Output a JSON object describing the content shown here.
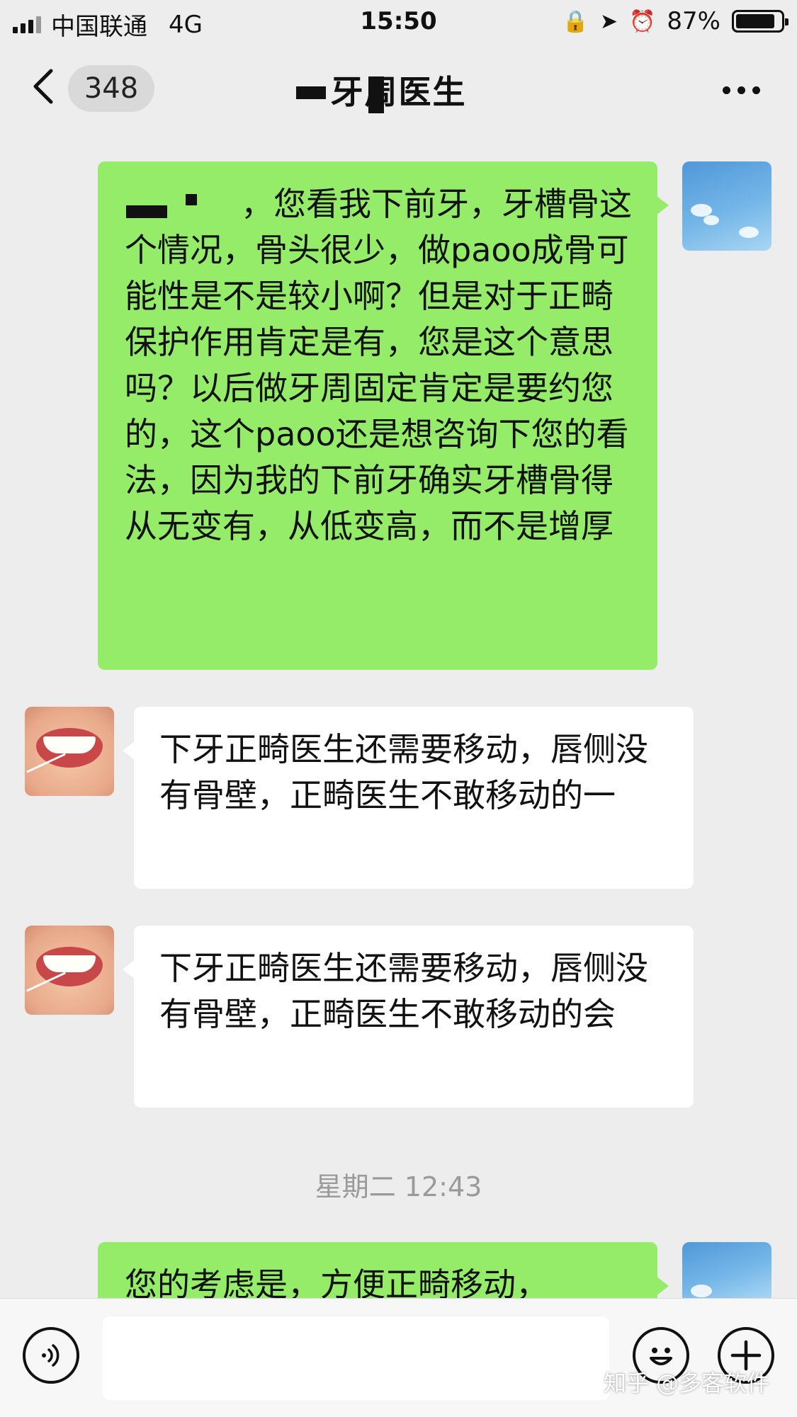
{
  "status_bar": {
    "carrier": "中国联通",
    "network": "4G",
    "time": "15:50",
    "battery": "87%"
  },
  "nav": {
    "unread_count": "348",
    "title": "牙周医生"
  },
  "messages": [
    {
      "side": "out",
      "text": "，您看我下前牙，牙槽骨这个情况，骨头很少，做paoo成骨可能性是不是较小啊？但是对于正畸保护作用肯定是有，您是这个意思吗？以后做牙周固定肯定是要约您的，这个paoo还是想咨询下您的看法，因为我的下前牙确实牙槽骨得从无变有，从低变高，而不是增厚"
    },
    {
      "side": "in",
      "text": "下牙正畸医生还需要移动，唇侧没有骨壁，正畸医生不敢移动的一"
    },
    {
      "side": "in",
      "text": "下牙正畸医生还需要移动，唇侧没有骨壁，正畸医生不敢移动的会"
    },
    {
      "side": "out",
      "text": "您的考虑是，方便正畸移动，"
    }
  ],
  "time_divider": "星期二 12:43",
  "watermark": "知乎 @多客软件",
  "colors": {
    "outgoing_bubble": "#95ec69",
    "incoming_bubble": "#ffffff",
    "background": "#ededed"
  }
}
